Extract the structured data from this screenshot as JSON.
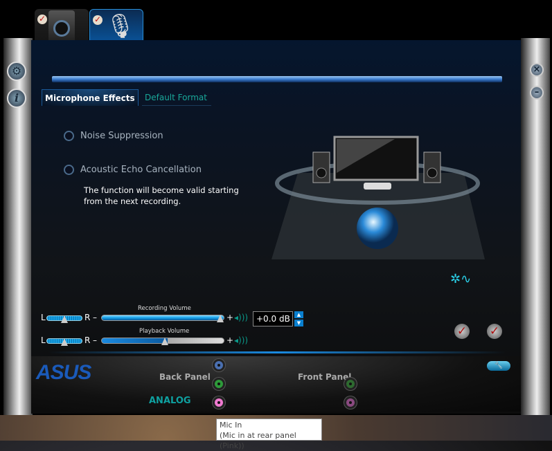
{
  "device_tabs": [
    {
      "name": "Speakers",
      "active": false,
      "checked": true
    },
    {
      "name": "Microphone",
      "active": true,
      "checked": true
    }
  ],
  "tabs": [
    {
      "label": "Microphone Effects",
      "active": true
    },
    {
      "label": "Default Format",
      "active": false
    }
  ],
  "effects": {
    "noise_suppression": {
      "label": "Noise Suppression",
      "checked": false
    },
    "echo_cancellation": {
      "label": "Acoustic Echo Cancellation",
      "checked": false
    },
    "note": "The function will become valid starting from the next recording."
  },
  "recording": {
    "label": "Recording Volume",
    "left": "L",
    "right": "R",
    "minus": "–",
    "plus": "+",
    "level_pct": 100,
    "balance_pct": 50,
    "db_value": "+0.0 dB"
  },
  "playback": {
    "label": "Playback Volume",
    "left": "L",
    "right": "R",
    "minus": "–",
    "plus": "+",
    "level_pct": 54,
    "balance_pct": 50
  },
  "bottom": {
    "brand": "ASUS",
    "back_panel": "Back Panel",
    "front_panel": "Front Panel",
    "analog": "ANALOG"
  },
  "jacks": {
    "back": [
      {
        "color": "#4a6fb0"
      },
      {
        "color": "#2e9a3a"
      },
      {
        "color": "#f07ad0"
      }
    ],
    "front": [
      {
        "color": "#2e6a30"
      },
      {
        "color": "#8a4a80"
      }
    ]
  },
  "tooltip": {
    "line1": "Mic In",
    "line2": "(Mic in at rear panel (Pink))"
  },
  "colors": {
    "accent": "#1aa0e8",
    "tab_inactive": "#19a89a",
    "analog": "#0fa0a0"
  }
}
